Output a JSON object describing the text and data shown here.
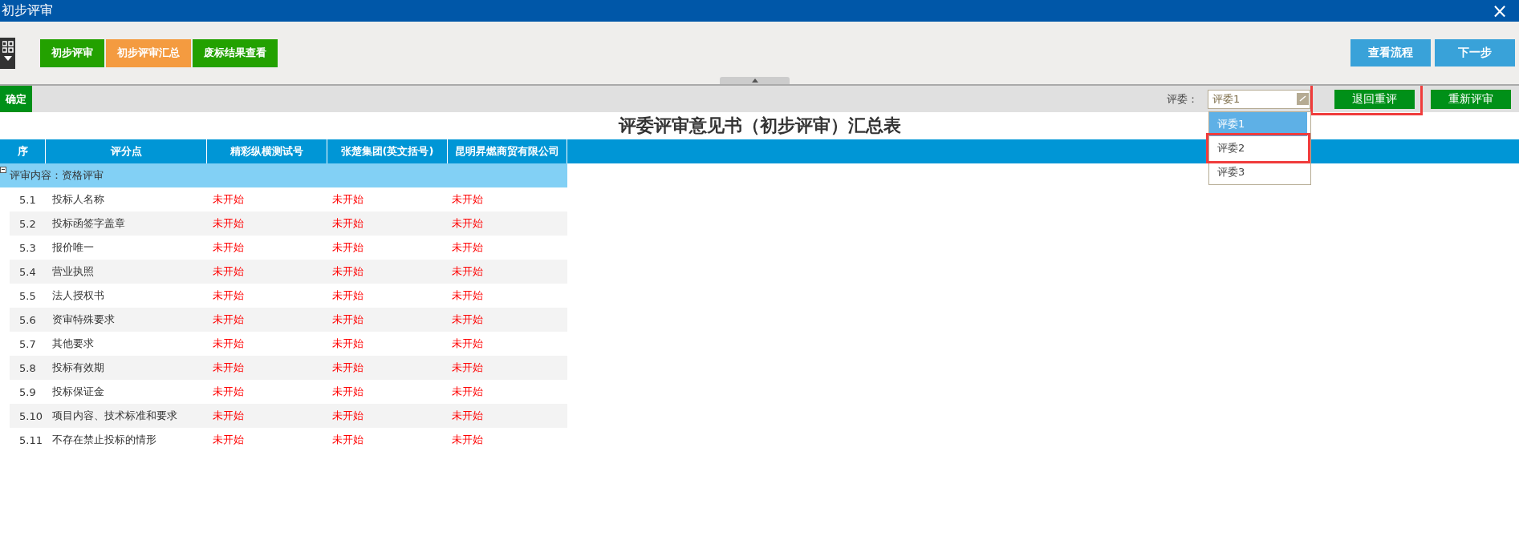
{
  "window": {
    "title": "初步评审",
    "close": "×"
  },
  "tabs": [
    {
      "label": "初步评审",
      "selected": false
    },
    {
      "label": "初步评审汇总",
      "selected": true
    },
    {
      "label": "废标结果查看",
      "selected": false
    }
  ],
  "toolbar_buttons": [
    "查看流程",
    "下一步"
  ],
  "action_bar": {
    "confirm": "确定",
    "reviewer_label": "评委：",
    "reviewer_value": "评委1",
    "options": [
      {
        "label": "评委1",
        "selected": true,
        "highlighted": false
      },
      {
        "label": "评委2",
        "selected": false,
        "highlighted": true
      },
      {
        "label": "评委3",
        "selected": false,
        "highlighted": false
      }
    ],
    "buttons": [
      {
        "label": "退回重评",
        "highlighted": true
      },
      {
        "label": "重新评审",
        "highlighted": false
      }
    ]
  },
  "report_title": "评委评审意见书（初步评审）汇总表",
  "table": {
    "columns": [
      "序",
      "评分点",
      "精彩纵横测试号",
      "张楚集团(英文括号)",
      "昆明昇燃商贸有限公司"
    ],
    "group": {
      "label": "评审内容：资格评审",
      "expanded": true,
      "rows": [
        [
          "5.1",
          "投标人名称",
          "未开始",
          "未开始",
          "未开始"
        ],
        [
          "5.2",
          "投标函签字盖章",
          "未开始",
          "未开始",
          "未开始"
        ],
        [
          "5.3",
          "报价唯一",
          "未开始",
          "未开始",
          "未开始"
        ],
        [
          "5.4",
          "营业执照",
          "未开始",
          "未开始",
          "未开始"
        ],
        [
          "5.5",
          "法人授权书",
          "未开始",
          "未开始",
          "未开始"
        ],
        [
          "5.6",
          "资审特殊要求",
          "未开始",
          "未开始",
          "未开始"
        ],
        [
          "5.7",
          "其他要求",
          "未开始",
          "未开始",
          "未开始"
        ],
        [
          "5.8",
          "投标有效期",
          "未开始",
          "未开始",
          "未开始"
        ],
        [
          "5.9",
          "投标保证金",
          "未开始",
          "未开始",
          "未开始"
        ],
        [
          "5.10",
          "项目内容、技术标准和要求",
          "未开始",
          "未开始",
          "未开始"
        ],
        [
          "5.11",
          "不存在禁止投标的情形",
          "未开始",
          "未开始",
          "未开始"
        ]
      ]
    }
  }
}
